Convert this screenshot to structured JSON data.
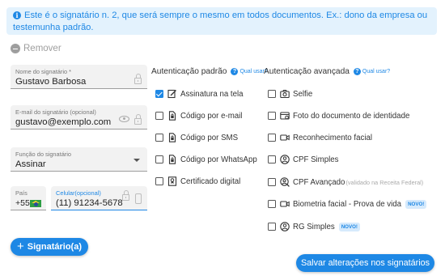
{
  "info": {
    "icon": "info-icon",
    "text": "Este é o signatário n. 2, que será sempre o mesmo em todos documentos. Ex.: dono da empresa ou testemunha padrão."
  },
  "remove_label": "Remover",
  "fields": {
    "name": {
      "label": "Nome do signatário *",
      "value": "Gustavo Barbosa"
    },
    "email": {
      "label": "E-mail do signatário (opcional)",
      "value": "gustavo@exemplo.com"
    },
    "function": {
      "label": "Função do signatário",
      "value": "Assinar"
    },
    "country": {
      "label": "País",
      "value": "+55"
    },
    "phone": {
      "label": "Celular(opcional)",
      "value": "(11) 91234-5678"
    }
  },
  "standard_auth": {
    "title": "Autenticação padrão",
    "help": "Qual usar?",
    "options": [
      {
        "label": "Assinatura na tela",
        "checked": true,
        "icon": "signature-icon"
      },
      {
        "label": "Código por e-mail",
        "checked": false,
        "icon": "email-code-icon"
      },
      {
        "label": "Código por SMS",
        "checked": false,
        "icon": "sms-code-icon"
      },
      {
        "label": "Código por WhatsApp",
        "checked": false,
        "icon": "whatsapp-code-icon"
      },
      {
        "label": "Certificado digital",
        "checked": false,
        "icon": "certificate-icon"
      }
    ]
  },
  "advanced_auth": {
    "title": "Autenticação avançada",
    "help": "Qual usar?",
    "options": [
      {
        "label": "Selfie",
        "checked": false,
        "icon": "camera-icon"
      },
      {
        "label": "Foto do documento de identidade",
        "checked": false,
        "icon": "id-photo-icon"
      },
      {
        "label": "Reconhecimento facial",
        "checked": false,
        "icon": "video-icon"
      },
      {
        "label": "CPF Simples",
        "checked": false,
        "icon": "person-icon"
      },
      {
        "label": "CPF Avançado",
        "note": "(validado na Receita Federal)",
        "checked": false,
        "icon": "person-search-icon"
      },
      {
        "label": "Biometria facial - Prova de vida",
        "badge": "NOVO!",
        "checked": false,
        "icon": "video-icon"
      },
      {
        "label": "RG Simples",
        "badge": "NOVO!",
        "checked": false,
        "icon": "person-icon"
      }
    ]
  },
  "buttons": {
    "add_signer": "Signatário(a)",
    "save": "Salvar alterações nos signatários"
  },
  "colors": {
    "accent": "#1e88e5",
    "info_bg": "#e3f2fd"
  }
}
